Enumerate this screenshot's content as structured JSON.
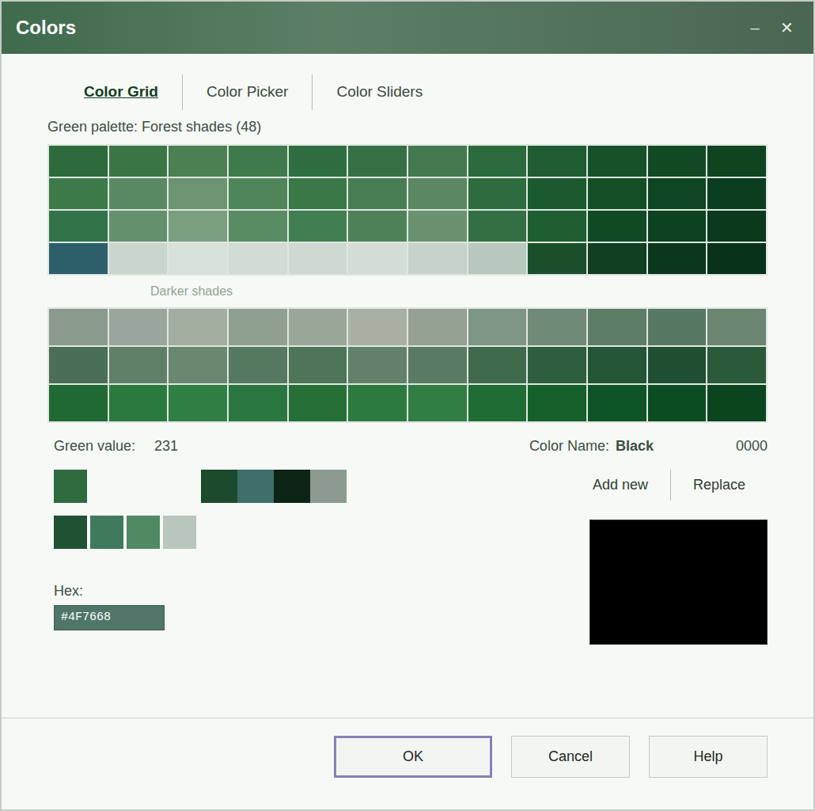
{
  "window": {
    "title": "Colors",
    "controls": [
      "–",
      "✕"
    ]
  },
  "tabs": [
    {
      "label": "Color Grid",
      "selected": true
    },
    {
      "label": "Color Picker",
      "selected": false
    },
    {
      "label": "Color Sliders",
      "selected": false
    }
  ],
  "palette_label": "Green palette: Forest shades (48)",
  "palette": {
    "rows": [
      [
        "#2d6a3c",
        "#3a7546",
        "#4b8052",
        "#3f7a4c",
        "#2f6e40",
        "#356f43",
        "#44784f",
        "#2a6a3b",
        "#1f5c31",
        "#17512a",
        "#124a25",
        "#0f4421"
      ],
      [
        "#3c7a4a",
        "#5a8a64",
        "#6b9472",
        "#4f8659",
        "#3b7848",
        "#477d52",
        "#5b8863",
        "#2c6c3d",
        "#1a5a2e",
        "#134e27",
        "#0e4522",
        "#0b3e1e"
      ],
      [
        "#33734a",
        "#64906e",
        "#7a9e80",
        "#5a8c64",
        "#427f50",
        "#4d8258",
        "#6a9270",
        "#336f42",
        "#1d5d30",
        "#114b25",
        "#0c421f",
        "#0a3a1b"
      ],
      [
        "#2c5f6a",
        "#c9d6cc",
        "#d8e0da",
        "#d2dcd4",
        "#cfd9d1",
        "#d4ddd6",
        "#c7d2ca",
        "#b9c8bc",
        "#1b4f2c",
        "#103f21",
        "#0b371c",
        "#09321a"
      ]
    ]
  },
  "note": "Darker shades",
  "shades": {
    "rows": [
      [
        "#8a9a8c",
        "#9aa69b",
        "#a2ad9f",
        "#8f9f90",
        "#9aa698",
        "#a8b0a4",
        "#95a193",
        "#7f9585",
        "#6f8a76",
        "#5d7d66",
        "#577862",
        "#6a8570"
      ],
      [
        "#4a6e56",
        "#5f7f67",
        "#6a8770",
        "#557a5f",
        "#4e7558",
        "#62806a",
        "#5a7b63",
        "#3f6a4c",
        "#2e5e3e",
        "#245535",
        "#1f4f30",
        "#2a5a3a"
      ],
      [
        "#1f6a34",
        "#2a7a3f",
        "#2f7f44",
        "#2a7640",
        "#267038",
        "#2c7a40",
        "#317e45",
        "#1f6d35",
        "#155f2b",
        "#0f5426",
        "#0c4c22",
        "#0a451f"
      ]
    ]
  },
  "green_value": {
    "label": "Green value:",
    "value": "231"
  },
  "color_name": {
    "label": "Color Name:",
    "value": "Black",
    "code": "0000"
  },
  "current": {
    "color": "#2f6b3f"
  },
  "recent": [
    {
      "color": "#1d4a2c"
    },
    {
      "color": "#3f6f6a"
    },
    {
      "color": "#0c2414"
    },
    {
      "color": "#8c9a90"
    }
  ],
  "actions": [
    "Add new",
    "Replace"
  ],
  "custom": [
    {
      "color": "#1e5232"
    },
    {
      "color": "#3f7a5c"
    },
    {
      "color": "#4f8a64"
    },
    {
      "color": "#b8c6bc"
    }
  ],
  "hex": {
    "label": "Hex:",
    "value": "#4F7668"
  },
  "preview": {
    "color": "#000000"
  },
  "buttons": [
    {
      "label": "OK",
      "default": true
    },
    {
      "label": "Cancel",
      "default": false
    },
    {
      "label": "Help",
      "default": false
    }
  ]
}
